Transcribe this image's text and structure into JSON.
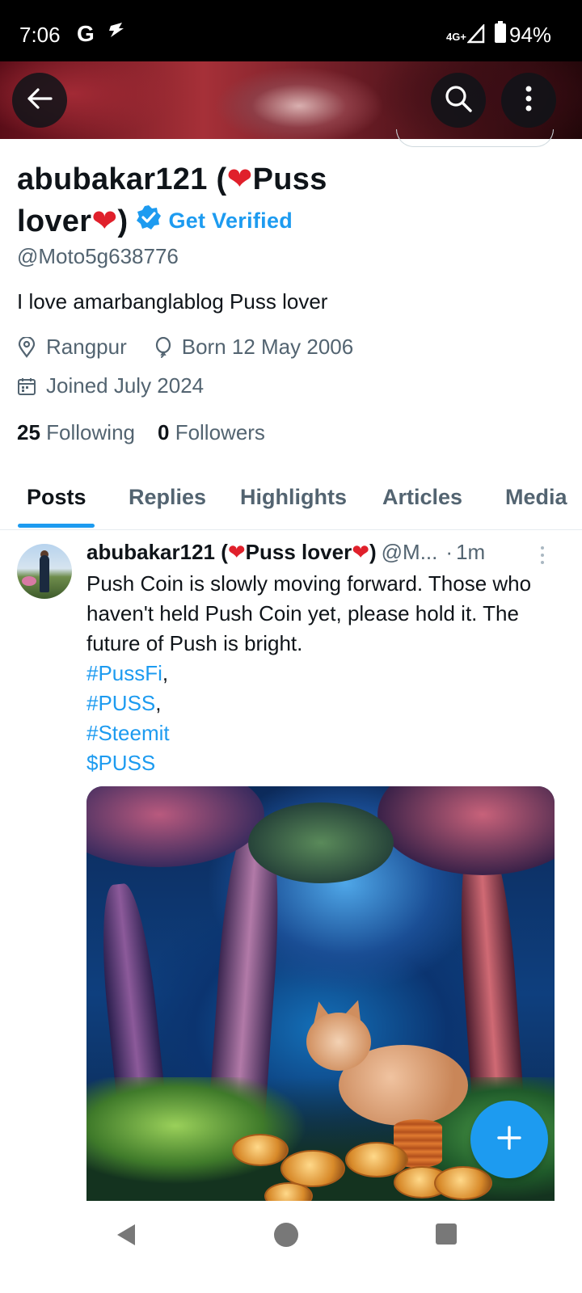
{
  "status_bar": {
    "time": "7:06",
    "g_icon": "G",
    "network": "4G+",
    "battery": "94%"
  },
  "header": {
    "back_icon": "arrow-left-icon",
    "search_icon": "search-icon",
    "more_icon": "more-vertical-icon"
  },
  "profile": {
    "name_part1": "abubakar121 (",
    "heart": "❤",
    "name_part2": "Puss",
    "name_part3": "lover",
    "name_part4": ")",
    "get_verified": "Get Verified",
    "handle": "@Moto5g638776",
    "bio": "I love amarbanglablog  Puss lover",
    "location": "Rangpur",
    "birthday": "Born 12 May 2006",
    "joined": "Joined July 2024",
    "following_count": "25",
    "following_label": "Following",
    "followers_count": "0",
    "followers_label": "Followers"
  },
  "tabs": [
    {
      "label": "Posts",
      "active": true
    },
    {
      "label": "Replies",
      "active": false
    },
    {
      "label": "Highlights",
      "active": false
    },
    {
      "label": "Articles",
      "active": false
    },
    {
      "label": "Media",
      "active": false
    }
  ],
  "post": {
    "author_name_a": "abubakar121 (",
    "author_name_b": "Puss lover",
    "author_name_c": ")",
    "author_handle": "@M...",
    "dot": "·",
    "time": "1m",
    "text": "Push Coin is slowly moving forward. Those who haven't held Push Coin yet, please hold it. The future of Push is bright.",
    "hashtags": [
      "#PussFi",
      "#PUSS",
      "#Steemit"
    ],
    "cashtag": "$PUSS",
    "comma": ","
  },
  "colors": {
    "accent": "#1d9bf0",
    "heart": "#e0202b",
    "secondary_text": "#536471"
  }
}
